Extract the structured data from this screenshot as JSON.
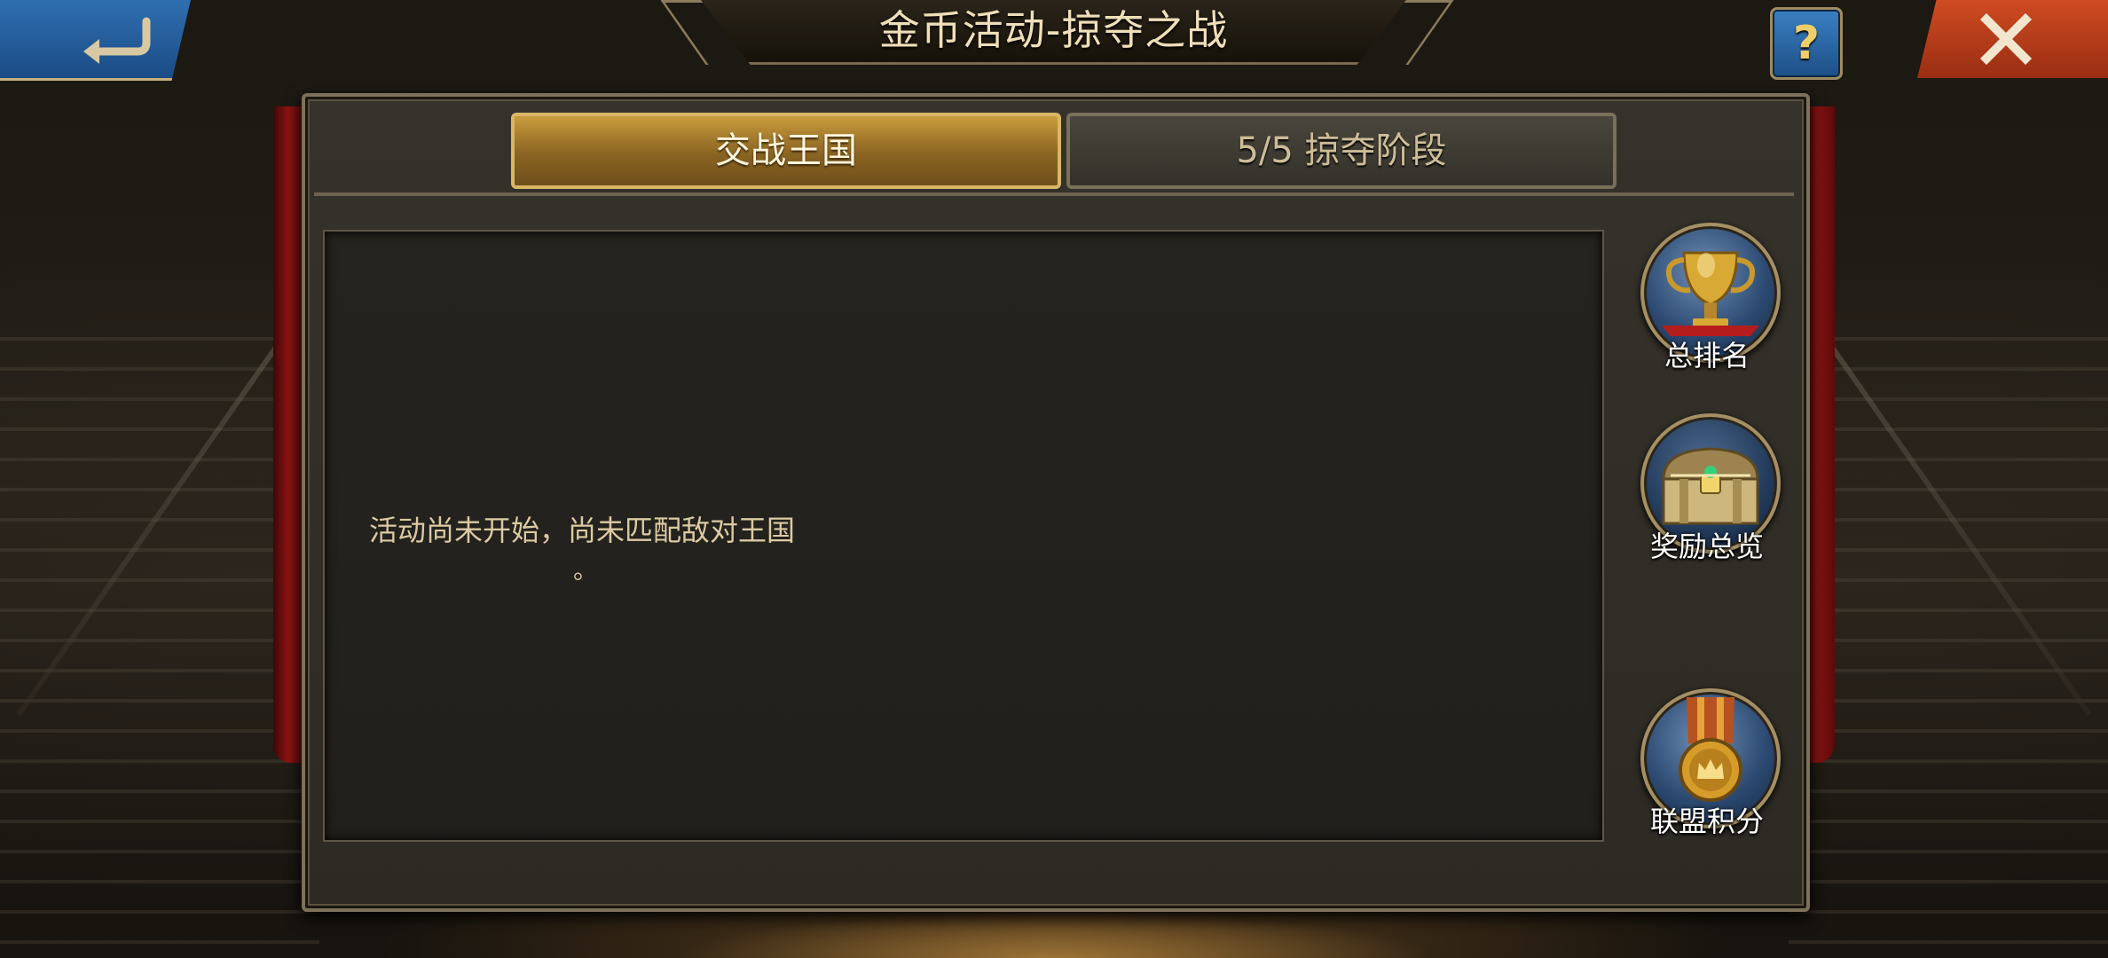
{
  "header": {
    "title": "金币活动-掠夺之战",
    "help_label": "?"
  },
  "tabs": [
    {
      "label": "交战王国",
      "active": true
    },
    {
      "label": "5/5 掠夺阶段",
      "active": false
    }
  ],
  "content": {
    "status_text": "活动尚未开始，尚未匹配敌对王国",
    "status_tail": "。"
  },
  "side_buttons": [
    {
      "label": "总排名",
      "icon": "trophy-icon"
    },
    {
      "label": "奖励总览",
      "icon": "treasure-chest-icon"
    },
    {
      "label": "联盟积分",
      "icon": "medal-icon"
    }
  ],
  "colors": {
    "back_button": "#2f6fb0",
    "close_button": "#cf4b22",
    "active_tab": "#c99c3e",
    "panel": "#35322b"
  }
}
